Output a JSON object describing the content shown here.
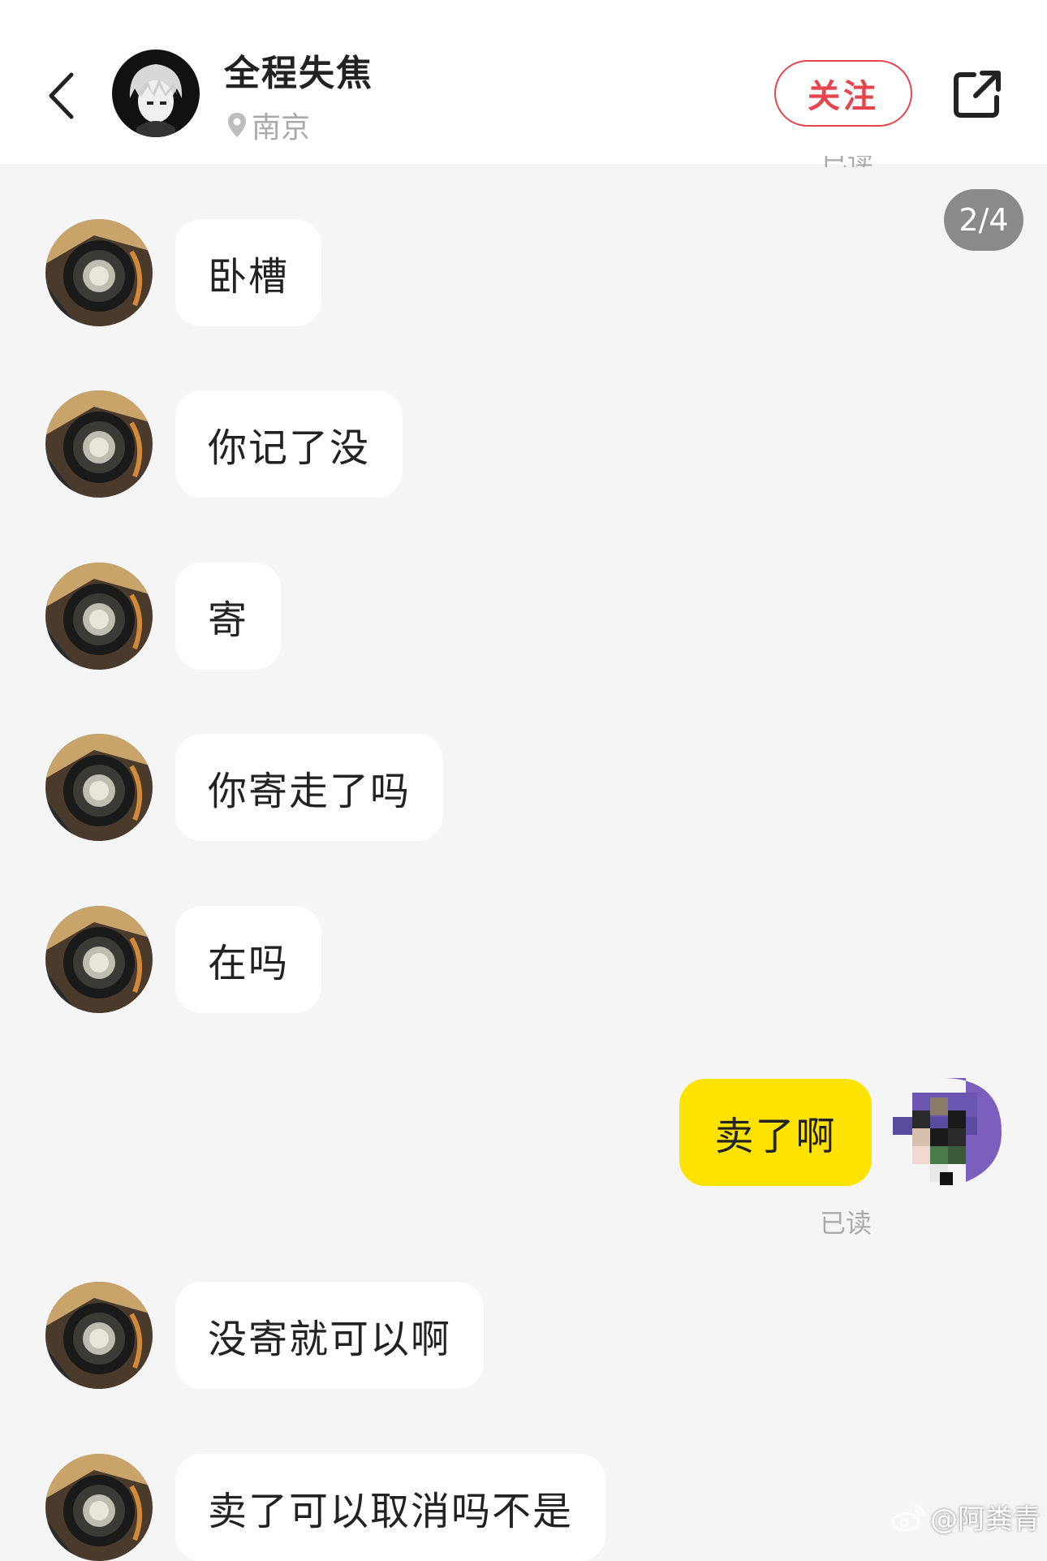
{
  "header": {
    "peer_name": "全程失焦",
    "location": "南京",
    "follow_label": "关注"
  },
  "overlay": {
    "page_indicator": "2/4",
    "read_status_top": "已读"
  },
  "messages": [
    {
      "from": "peer",
      "text": "卧槽"
    },
    {
      "from": "peer",
      "text": "你记了没"
    },
    {
      "from": "peer",
      "text": "寄"
    },
    {
      "from": "peer",
      "text": "你寄走了吗"
    },
    {
      "from": "peer",
      "text": "在吗"
    },
    {
      "from": "self",
      "text": "卖了啊",
      "status": "已读"
    },
    {
      "from": "peer",
      "text": "没寄就可以啊"
    },
    {
      "from": "peer",
      "text": "卖了可以取消吗不是"
    }
  ],
  "watermark": "@阿粪青",
  "colors": {
    "accent": "#e5454c",
    "self_bubble": "#ffe300",
    "background": "#f5f5f5",
    "page_indicator_bg": "#8a8a8a"
  },
  "icons": [
    "back-arrow-icon",
    "location-pin-icon",
    "share-icon",
    "weibo-icon"
  ]
}
